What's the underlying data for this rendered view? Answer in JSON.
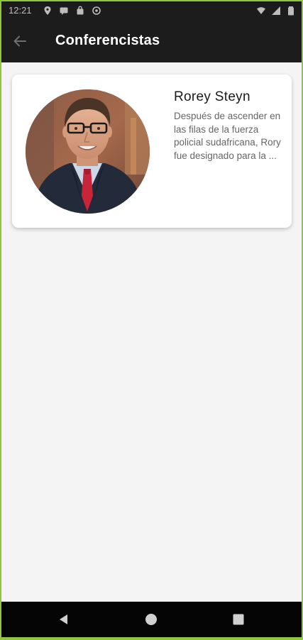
{
  "status_bar": {
    "time": "12:21"
  },
  "app_bar": {
    "title": "Conferencistas"
  },
  "speakers": [
    {
      "name": "Rorey Steyn",
      "bio": "Después de ascender en las filas de la fuerza policial sudafricana, Rory fue designado para la ..."
    }
  ],
  "colors": {
    "app_bar_bg": "#1c1c1c",
    "content_bg": "#f4f4f4",
    "card_bg": "#ffffff",
    "frame_accent": "#8ec63f"
  },
  "icons": {
    "back": "arrow-left-icon",
    "nav_back": "triangle-back-icon",
    "nav_home": "circle-home-icon",
    "nav_recents": "square-recents-icon"
  }
}
